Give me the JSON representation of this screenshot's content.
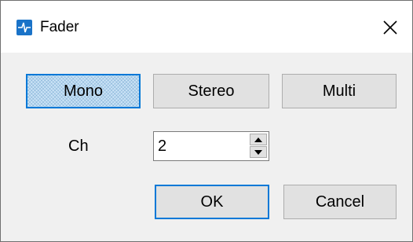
{
  "window": {
    "title": "Fader",
    "app_icon": "fader-app-icon",
    "close_icon": "close-icon"
  },
  "mode": {
    "options": [
      "Mono",
      "Stereo",
      "Multi"
    ],
    "selected": "Mono"
  },
  "channel": {
    "label": "Ch",
    "value": "2",
    "up_icon": "spin-up-icon",
    "down_icon": "spin-down-icon"
  },
  "actions": {
    "ok_label": "OK",
    "cancel_label": "Cancel"
  },
  "colors": {
    "accent": "#0078d7",
    "app_icon_blue": "#1a73c8"
  }
}
